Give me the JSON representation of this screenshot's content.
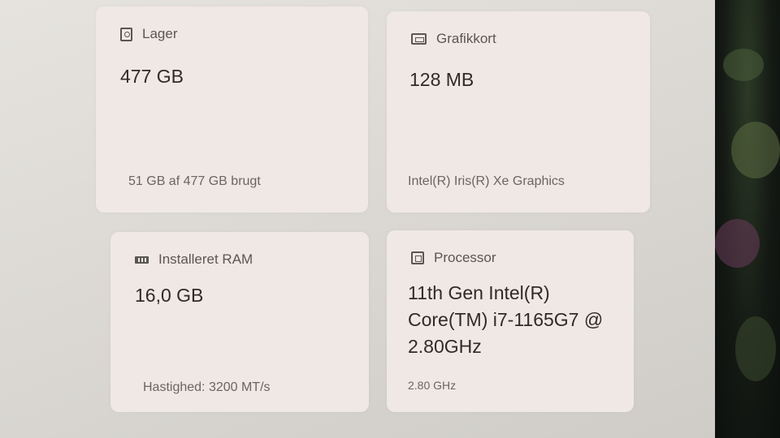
{
  "cards": [
    {
      "title": "Lager",
      "icon": "storage-drive-icon",
      "value_lines": [
        "477 GB"
      ],
      "footer": "51 GB af 477 GB brugt"
    },
    {
      "title": "Grafikkort",
      "icon": "graphics-card-icon",
      "value_lines": [
        "128 MB"
      ],
      "footer": "Intel(R) Iris(R) Xe Graphics"
    },
    {
      "title": "Installeret RAM",
      "icon": "ram-module-icon",
      "value_lines": [
        "16,0 GB"
      ],
      "footer": "Hastighed: 3200 MT/s"
    },
    {
      "title": "Processor",
      "icon": "processor-chip-icon",
      "value_lines": [
        "11th Gen Intel(R)",
        "Core(TM) i7-1165G7 @",
        "2.80GHz"
      ],
      "footer": "2.80 GHz"
    }
  ]
}
